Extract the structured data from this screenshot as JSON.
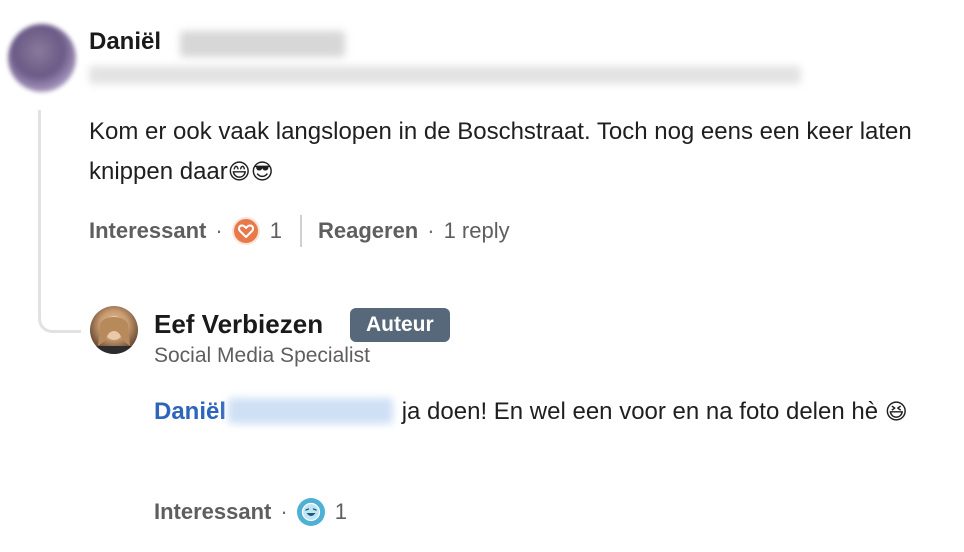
{
  "comment": {
    "author_first_name": "Daniël",
    "text_before_emoji": "Kom er ook vaak langslopen in de Boschstraat. Toch nog eens een keer laten knippen daar",
    "emojis": "😄😎",
    "actions": {
      "like_label": "Interessant",
      "reaction_count": "1",
      "reply_label": "Reageren",
      "reply_count_text": "1 reply"
    },
    "reaction_icon": "heart-icon"
  },
  "reply": {
    "author_name": "Eef Verbiezen",
    "author_badge": "Auteur",
    "author_headline": "Social Media Specialist",
    "mention_first_name": "Daniël",
    "text_after_mention": " ja doen! En wel een voor en na foto delen hè ",
    "emoji": "😆",
    "actions": {
      "like_label": "Interessant",
      "reaction_count": "1"
    },
    "reaction_icon": "funny-icon"
  },
  "colors": {
    "mention": "#2d64bc",
    "badge_bg": "#56687a",
    "heart_reaction": "#e7794a",
    "funny_reaction": "#4fb0d6"
  }
}
